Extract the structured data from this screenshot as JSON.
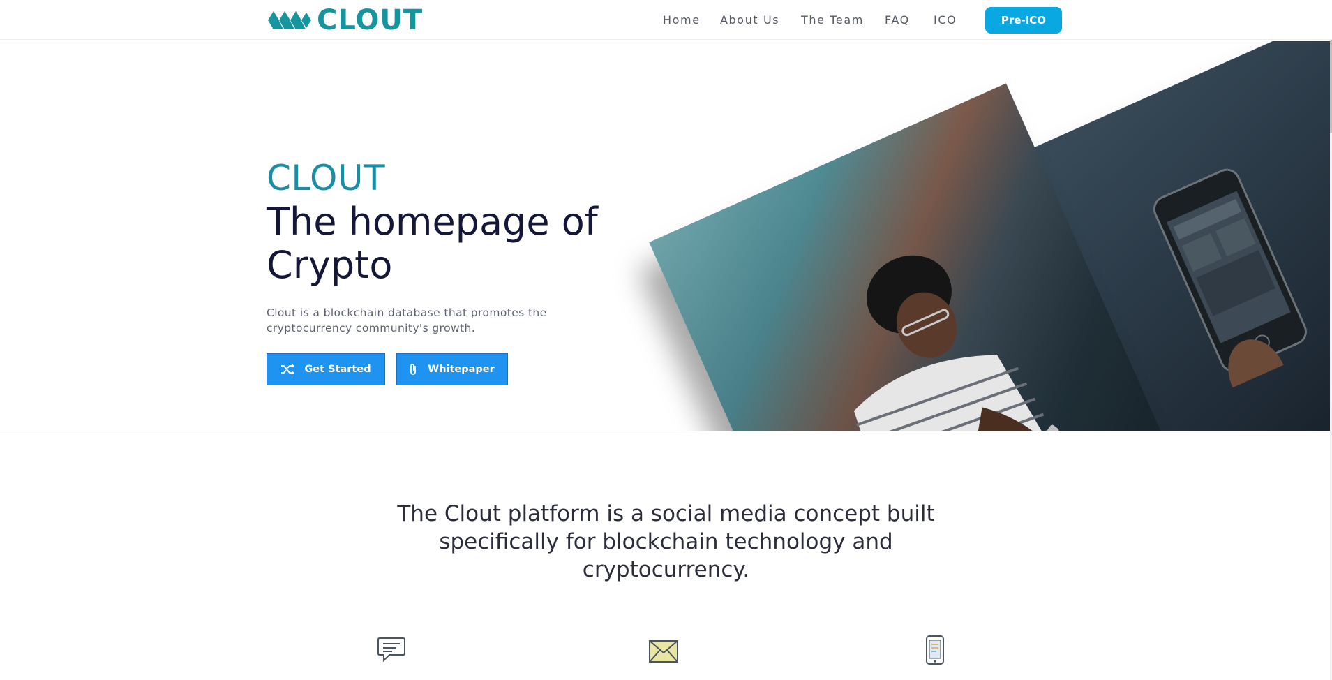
{
  "header": {
    "logo_text": "CLOUT",
    "nav": [
      "Home",
      "About Us",
      "The Team",
      "FAQ",
      "ICO"
    ],
    "cta": "Pre-ICO"
  },
  "hero": {
    "brand": "CLOUT",
    "title_line1": "The homepage of",
    "title_line2": "Crypto",
    "subtitle": "Clout is a blockchain database that promotes the cryptocurrency community's growth.",
    "buttons": {
      "get_started": "Get Started",
      "whitepaper": "Whitepaper"
    }
  },
  "intro": {
    "lead": "The Clout platform is a social media concept built specifically for blockchain technology and cryptocurrency."
  },
  "features": {
    "icons": [
      "chat-bubble-icon",
      "envelope-icon",
      "mobile-phone-icon"
    ]
  },
  "colors": {
    "brand_teal": "#17959f",
    "title_teal": "#1a8ea4",
    "cta_blue": "#0aa8e1",
    "button_blue": "#1e93f0",
    "heading_navy": "#141738"
  }
}
